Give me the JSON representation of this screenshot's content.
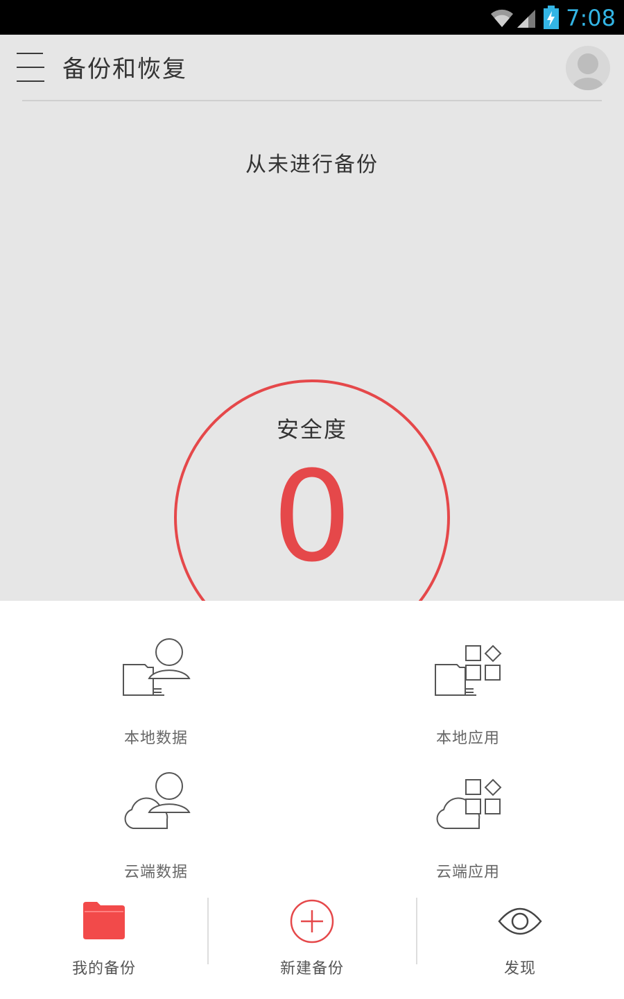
{
  "status_bar": {
    "time": "7:08"
  },
  "header": {
    "title": "备份和恢复"
  },
  "main": {
    "backup_status": "从未进行备份",
    "safety": {
      "label": "安全度",
      "value": "0",
      "accent": "#e5484a"
    }
  },
  "tiles": [
    {
      "label": "本地数据",
      "icon": "local-data-icon"
    },
    {
      "label": "本地应用",
      "icon": "local-apps-icon"
    },
    {
      "label": "云端数据",
      "icon": "cloud-data-icon"
    },
    {
      "label": "云端应用",
      "icon": "cloud-apps-icon"
    }
  ],
  "bottom_nav": [
    {
      "label": "我的备份",
      "icon": "folder-icon"
    },
    {
      "label": "新建备份",
      "icon": "add-circle-icon"
    },
    {
      "label": "发现",
      "icon": "eye-icon"
    }
  ],
  "colors": {
    "accent_red": "#e5484a",
    "folder_red": "#f24a4a",
    "status_time": "#33b5e5"
  }
}
